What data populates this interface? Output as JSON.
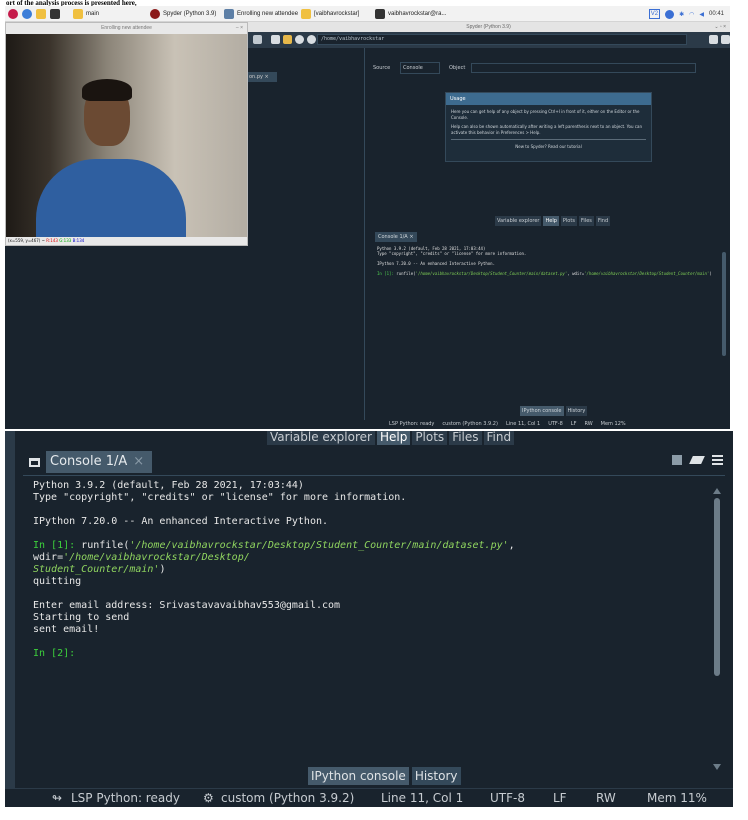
{
  "caption": "ort of the analysis process is presented here,",
  "taskbar": {
    "items": [
      {
        "label": "main",
        "icon": "folder-icon"
      },
      {
        "label": "Spyder (Python 3.9)",
        "icon": "spyder-icon"
      },
      {
        "label": "Enrolling new attendee",
        "icon": "window-icon"
      },
      {
        "label": "[vaibhavrockstar]",
        "icon": "folder-icon"
      },
      {
        "label": "vaibhavrockstar@ra...",
        "icon": "terminal-icon"
      }
    ],
    "clock": "00:41",
    "tray_badge": "V2"
  },
  "camera_window": {
    "title": "Enrolling new attendee",
    "window_controls": "– ×",
    "status_prefix": "(x=559, y=467) ~",
    "status_r": "R:143",
    "status_g": "G:133",
    "status_b": "B:134"
  },
  "spyder": {
    "title": "Spyder (Python 3.9)",
    "window_controls": "⌄ ▫ ×",
    "path": "/home/vaibhavrockstar",
    "editor_tab": "on.py ×",
    "source_label": "Source",
    "source_value": "Console",
    "object_label": "Object",
    "usage": {
      "title": "Usage",
      "p1": "Here you can get help of any object by pressing Ctrl+I in front of it, either on the Editor or the Console.",
      "p2": "Help can also be shown automatically after writing a left parenthesis next to an object. You can activate this behavior in Preferences > Help.",
      "p3": "New to Spyder? Read our tutorial"
    },
    "help_tabs": [
      "Variable explorer",
      "Help",
      "Plots",
      "Files",
      "Find"
    ],
    "small_console_tab": "Console 1/A ×",
    "small_console_lines": {
      "l1": "Python 3.9.2 (default, Feb 28 2021, 17:03:44)",
      "l2": "Type \"copyright\", \"credits\" or \"license\" for more information.",
      "l3": "IPython 7.20.0 -- An enhanced Interactive Python.",
      "prompt": "In [1]: ",
      "cmd": "runfile(",
      "arg1": "'/home/vaibhavrockstar/Desktop/Student_Counter/main/dataset.py'",
      "mid": ", wdir=",
      "arg2": "'/home/vaibhavrockstar/Desktop/Student_Counter/main'",
      "end": ")"
    },
    "console_bottom_tabs": [
      "IPython console",
      "History"
    ],
    "status": {
      "lsp": "LSP Python: ready",
      "env": "custom (Python 3.9.2)",
      "pos": "Line 11, Col 1",
      "enc": "UTF-8",
      "eol": "LF",
      "rw": "RW",
      "mem": "Mem 12%"
    }
  },
  "zoomed": {
    "top_tabs": [
      "Variable explorer",
      "Help",
      "Plots",
      "Files",
      "Find"
    ],
    "console_tab": "Console 1/A",
    "console_tab_close": "×",
    "lines": {
      "l1": "Python 3.9.2 (default, Feb 28 2021, 17:03:44)",
      "l2": "Type \"copyright\", \"credits\" or \"license\" for more information.",
      "l3": "IPython 7.20.0 -- An enhanced Interactive Python.",
      "prompt1": "In [1]: ",
      "cmd": "runfile(",
      "arg1": "'/home/vaibhavrockstar/Desktop/Student_Counter/main/dataset.py'",
      "mid": ", wdir=",
      "arg2a": "'/home/vaibhavrockstar/Desktop/",
      "arg2b": "Student_Counter/main'",
      "end": ")",
      "out1": "quitting",
      "out2": "Enter email address: Srivastavavaibhav553@gmail.com",
      "out3": "Starting to send",
      "out4": "sent email!",
      "prompt2": "In [2]:"
    },
    "bottom_tabs": [
      "IPython console",
      "History"
    ],
    "status": {
      "lsp": "LSP Python: ready",
      "env": "custom (Python 3.9.2)",
      "pos": "Line 11, Col 1",
      "enc": "UTF-8",
      "eol": "LF",
      "rw": "RW",
      "mem": "Mem 11%"
    }
  },
  "colors": {
    "spyder_bg": "#19232d",
    "panel_tab": "#455a6b",
    "prompt_green": "#3ccf3c",
    "string_green": "#8fd45f"
  }
}
